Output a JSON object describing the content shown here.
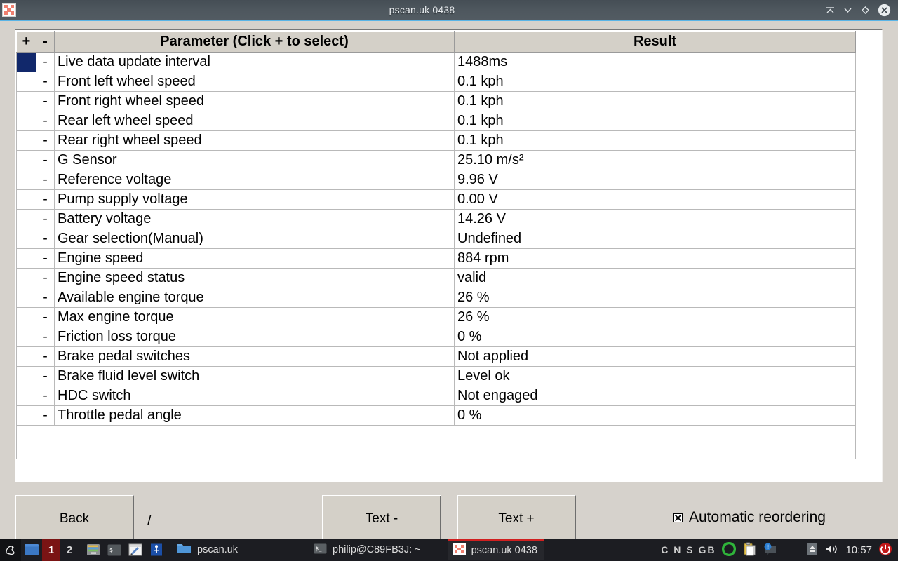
{
  "window": {
    "title": "pscan.uk 0438",
    "icon": "app-icon",
    "controls": {
      "shade": "shade-icon",
      "minimize": "chevron-down-icon",
      "maximize": "diamond-icon",
      "close": "close-icon"
    }
  },
  "table": {
    "headers": {
      "plus": "+",
      "minus": "-",
      "parameter": "Parameter (Click + to select)",
      "result": "Result"
    },
    "minus_mark": "-",
    "selected_row_index": 0,
    "selected_color": "#11286b",
    "rows": [
      {
        "parameter": "Live data update interval",
        "result": "1488ms"
      },
      {
        "parameter": "Front left wheel speed",
        "result": "0.1 kph"
      },
      {
        "parameter": "Front right wheel speed",
        "result": "0.1 kph"
      },
      {
        "parameter": "Rear left wheel speed",
        "result": "0.1 kph"
      },
      {
        "parameter": "Rear right wheel speed",
        "result": "0.1 kph"
      },
      {
        "parameter": "G Sensor",
        "result": "25.10 m/s²"
      },
      {
        "parameter": "Reference voltage",
        "result": "9.96 V"
      },
      {
        "parameter": "Pump supply voltage",
        "result": "0.00 V"
      },
      {
        "parameter": "Battery voltage",
        "result": "14.26 V"
      },
      {
        "parameter": "Gear selection(Manual)",
        "result": "Undefined"
      },
      {
        "parameter": "Engine speed",
        "result": "884 rpm"
      },
      {
        "parameter": "Engine speed status",
        "result": "valid"
      },
      {
        "parameter": "Available engine torque",
        "result": "26 %"
      },
      {
        "parameter": "Max engine torque",
        "result": "26 %"
      },
      {
        "parameter": "Friction loss torque",
        "result": "0 %"
      },
      {
        "parameter": "Brake pedal switches",
        "result": "Not applied"
      },
      {
        "parameter": "Brake fluid level switch",
        "result": "Level ok"
      },
      {
        "parameter": "HDC switch",
        "result": "Not engaged"
      },
      {
        "parameter": "Throttle pedal angle",
        "result": "0 %"
      }
    ]
  },
  "controls": {
    "back_label": "Back",
    "page_label": "/",
    "text_minus_label": "Text -",
    "text_plus_label": "Text +",
    "auto_reorder_label": "Automatic reordering",
    "auto_reorder_checked": true
  },
  "taskbar": {
    "menu_icon": "bird-menu-icon",
    "show_desktop_icon": "window-icon",
    "desktops": [
      {
        "label": "1",
        "active": true
      },
      {
        "label": "2",
        "active": false
      }
    ],
    "launchers": [
      {
        "icon": "file-manager-icon"
      },
      {
        "icon": "terminal-icon"
      },
      {
        "icon": "text-editor-icon"
      },
      {
        "icon": "network-icon"
      }
    ],
    "windows": [
      {
        "title": "pscan.uk",
        "icon": "folder-icon",
        "active": false
      },
      {
        "title": "philip@C89FB3J: ~",
        "icon": "terminal-icon",
        "active": false
      },
      {
        "title": "pscan.uk 0438",
        "icon": "app-icon",
        "active": true
      }
    ],
    "tray": {
      "keyboard_indicators": "C N S GB",
      "status_icon": "green-dash-icon",
      "clipboard_icon": "clipboard-icon",
      "update_icon": "update-alert-icon",
      "eject_icon": "eject-icon",
      "volume_icon": "speaker-icon",
      "clock": "10:57",
      "power_icon": "power-icon"
    }
  }
}
